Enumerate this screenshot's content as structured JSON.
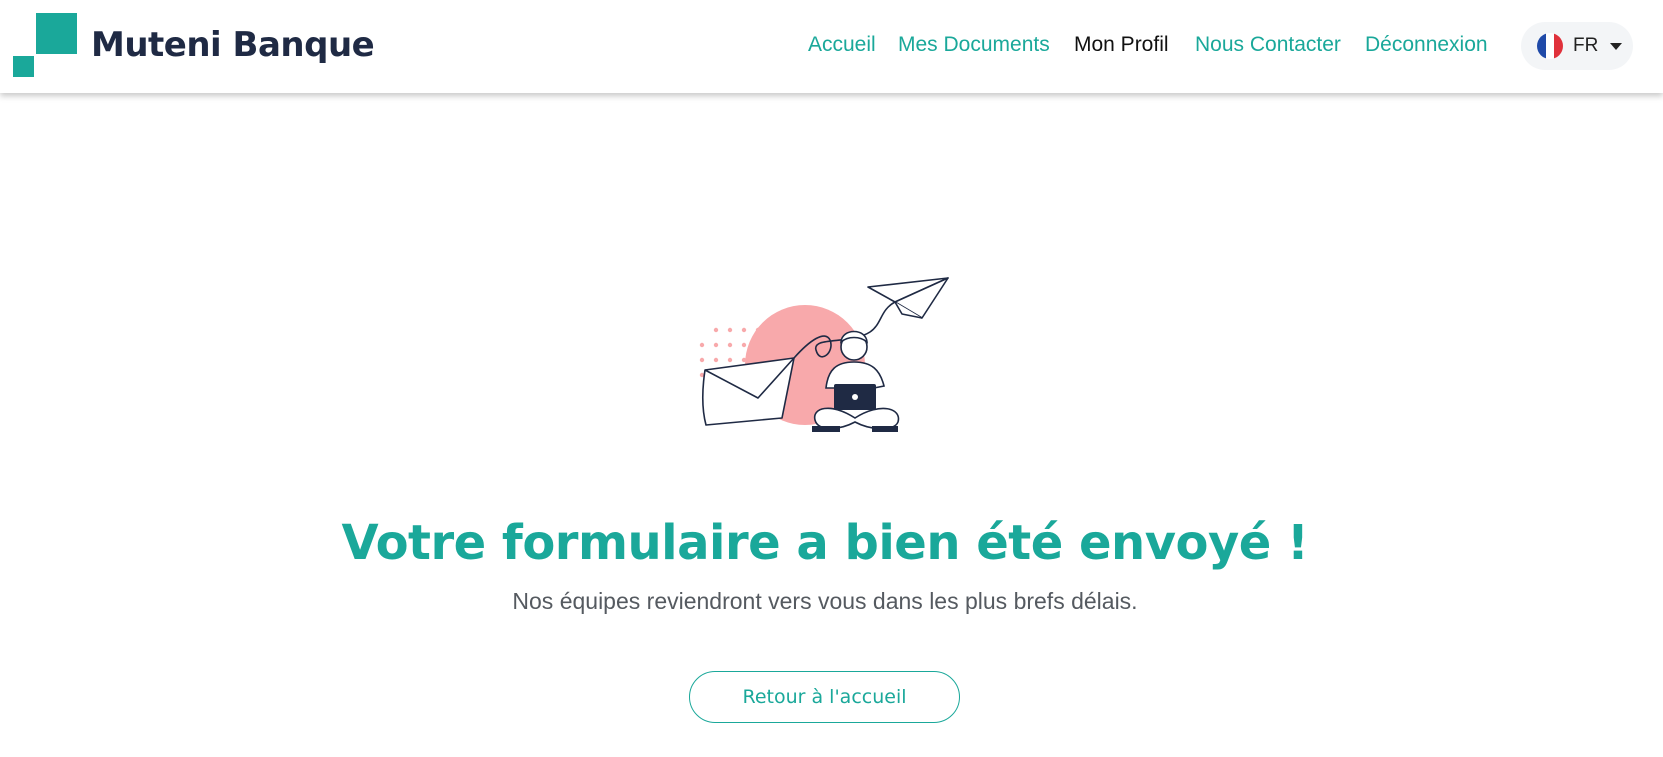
{
  "brand": {
    "name": "Muteni Banque"
  },
  "nav": {
    "items": [
      {
        "label": "Accueil",
        "active": false
      },
      {
        "label": "Mes Documents",
        "active": false
      },
      {
        "label": "Mon Profil",
        "active": true
      },
      {
        "label": "Nous Contacter",
        "active": false
      },
      {
        "label": "Déconnexion",
        "active": false
      }
    ],
    "language": {
      "code": "FR",
      "flag": "france-flag-icon"
    }
  },
  "main": {
    "headline": "Votre formulaire a bien été envoyé !",
    "subtext": "Nos équipes reviendront vers vous dans les plus brefs délais.",
    "back_button": "Retour à l'accueil"
  },
  "colors": {
    "accent": "#1aa89a",
    "navy": "#1f2a44",
    "illustration_pink": "#f8a9ab",
    "active_nav": "#111111"
  }
}
